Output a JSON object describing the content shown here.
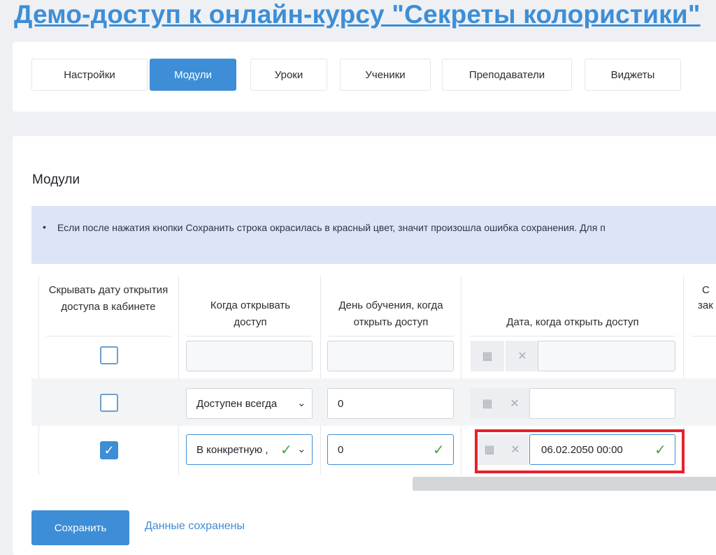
{
  "page": {
    "title": "Демо-доступ к онлайн-курсу \"Секреты колористики\""
  },
  "tabs": [
    {
      "label": "Настройки",
      "active": false
    },
    {
      "label": "Модули",
      "active": true
    },
    {
      "label": "Уроки",
      "active": false
    },
    {
      "label": "Ученики",
      "active": false
    },
    {
      "label": "Преподаватели",
      "active": false
    },
    {
      "label": "Виджеты",
      "active": false
    }
  ],
  "section": {
    "title": "Модули"
  },
  "alert": {
    "bullet": "•",
    "text": "Если после нажатия кнопки Сохранить строка окрасилась в красный цвет, значит произошла ошибка сохранения. Для п"
  },
  "table": {
    "headers": {
      "hide_date": "Скрывать дату открытия доступа в кабинете",
      "when_open": "Когда открывать доступ",
      "day_open": "День обучения, когда открыть доступ",
      "date_open": "Дата, когда открыть доступ",
      "cut_top": "С",
      "cut_bottom": "зак"
    },
    "rows": [
      {
        "hide_checked": false,
        "when": "",
        "day": "",
        "date": ""
      },
      {
        "hide_checked": false,
        "when": "Доступен всегда",
        "day": "0",
        "date": ""
      },
      {
        "hide_checked": true,
        "when": "В конкретную ,",
        "day": "0",
        "date": "06.02.2050 00:00"
      }
    ]
  },
  "icons": {
    "calendar": "calendar-icon",
    "clear": "clear-icon",
    "check": "check-icon",
    "chevron": "chevron-down-icon"
  },
  "footer": {
    "save_label": "Сохранить",
    "status": "Данные сохранены"
  },
  "colors": {
    "accent": "#3d8ed6",
    "success": "#3fa54a",
    "highlight": "#e8202a",
    "alert_bg": "#dde4f8"
  }
}
